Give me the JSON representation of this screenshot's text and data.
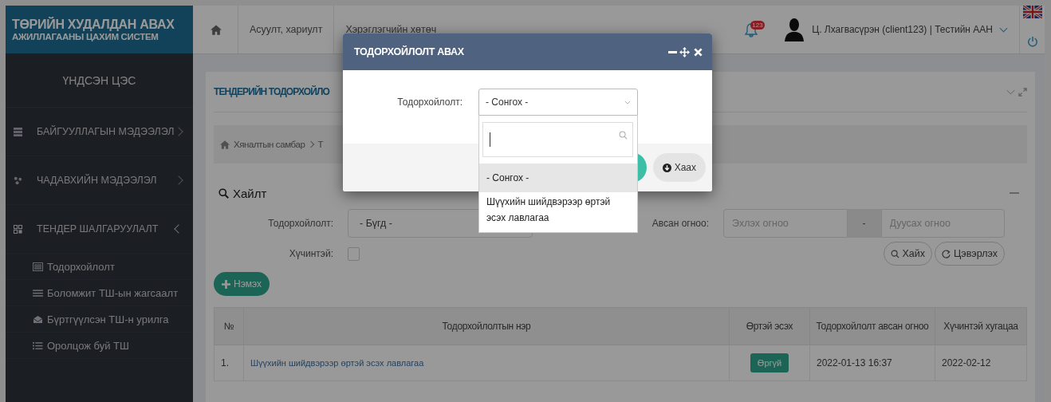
{
  "brand": {
    "line1": "ТӨРИЙН ХУДАЛДАН АВАХ",
    "line2": "АЖИЛЛАГААНЫ ЦАХИМ СИСТЕМ"
  },
  "topnav": [
    "Асуулт, хариулт",
    "Хэрэглэгчийн хөтөч"
  ],
  "notifications": {
    "count": "123"
  },
  "user": {
    "name": "Ц. Лхагвасүрэн (client123) | Тестийн ААН"
  },
  "sidebar": {
    "heading": "ҮНДСЭН ЦЭС",
    "items": [
      {
        "label": "БАЙГУУЛЛАГЫН МЭДЭЭЛЭЛ",
        "expanded": false
      },
      {
        "label": "ЧАДАВХИЙН МЭДЭЭЛЭЛ",
        "expanded": false
      },
      {
        "label": "ТЕНДЕР ШАЛГАРУУЛАЛТ",
        "expanded": true,
        "children": [
          {
            "label": "Тодорхойлолт"
          },
          {
            "label": "Боломжит ТШ-ын жагсаалт"
          },
          {
            "label": "Бүртгүүлсэн ТШ-н урилга"
          },
          {
            "label": "Оролцож буй ТШ"
          }
        ]
      }
    ]
  },
  "page": {
    "title": "ТЕНДЕРИЙН ТОДОРХОЙЛО",
    "breadcrumb": [
      "Хяналтын самбар",
      "Т"
    ]
  },
  "search": {
    "title": "Хайлт",
    "type_label": "Тодорхойлолт:",
    "type_value": "- Бүгд -",
    "date_label": "Авсан огноо:",
    "date_from_placeholder": "Эхлэх огноо",
    "date_sep": "-",
    "date_to_placeholder": "Дуусах огноо",
    "valid_label": "Хүчинтэй:",
    "valid_checked": false,
    "buttons": [
      {
        "kind": "search",
        "label": "Хайх"
      },
      {
        "kind": "reset",
        "label": "Цэвэрлэх"
      }
    ]
  },
  "add_button": "Нэмэх",
  "table": {
    "columns": [
      "№",
      "Тодорхойлолтын нэр",
      "Өртэй эсэх",
      "Тодорхойлолт авсан огноо",
      "Хүчинтэй хугацаа"
    ],
    "rows": [
      {
        "no": "1.",
        "name": "Шүүхийн шийдвэрээр өртэй эсэх лавлагаа",
        "debt": "Өргүй",
        "date": "2022-01-13 16:37",
        "valid": "2022-02-12"
      }
    ]
  },
  "modal": {
    "title": "ТОДОРХОЙЛОЛТ АВАХ",
    "field_label": "Тодорхойлолт:",
    "field_value": "- Сонгох -",
    "close_button": "Хаах",
    "options": [
      {
        "label": "- Сонгох -",
        "selected": true
      },
      {
        "label": "Шүүхийн шийдвэрээр өртэй эсэх лавлагаа",
        "selected": false
      }
    ]
  }
}
